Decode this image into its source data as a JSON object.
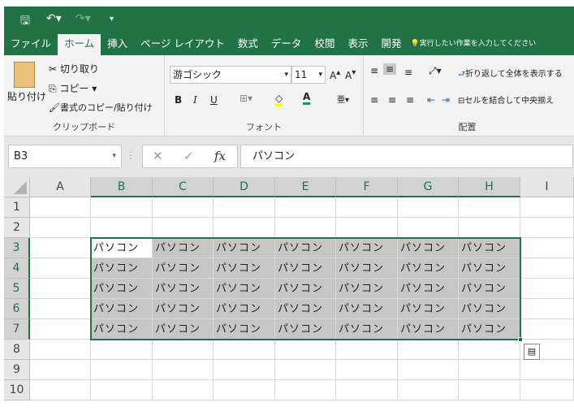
{
  "qat": {
    "save_icon": "save-icon",
    "undo_icon": "undo-icon",
    "redo_icon": "redo-icon",
    "customize_icon": "customize-qat-icon"
  },
  "tabs": [
    "ファイル",
    "ホーム",
    "挿入",
    "ページ レイアウト",
    "数式",
    "データ",
    "校閲",
    "表示",
    "開発"
  ],
  "active_tab": "ホーム",
  "tell_me": "実行したい作業を入力してください",
  "clipboard": {
    "paste": "貼り付け",
    "cut": "切り取り",
    "copy": "コピー",
    "format_painter": "書式のコピー/貼り付け",
    "label": "クリップボード"
  },
  "font": {
    "name": "游ゴシック",
    "size": "11",
    "bold": "B",
    "italic": "I",
    "underline": "U",
    "label": "フォント",
    "fill_color": "#ffff00",
    "font_color": "#00a651"
  },
  "alignment": {
    "wrap": "折り返して全体を表示する",
    "merge": "セルを結合して中央揃え",
    "label": "配置"
  },
  "formula_bar": {
    "name_box": "B3",
    "fx": "fx",
    "value": "パソコン"
  },
  "grid": {
    "columns": [
      "A",
      "B",
      "C",
      "D",
      "E",
      "F",
      "G",
      "H",
      "I"
    ],
    "rows": [
      "1",
      "2",
      "3",
      "4",
      "5",
      "6",
      "7",
      "8",
      "9",
      "10"
    ],
    "selected_range": "B3:H7",
    "active_cell": "B3",
    "cell_value": "パソコン"
  },
  "accent": "#217346"
}
